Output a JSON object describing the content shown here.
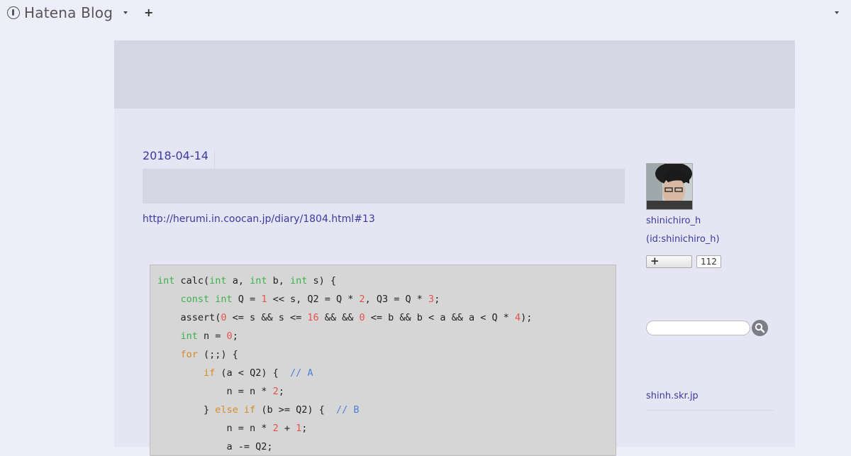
{
  "global_header": {
    "brand": "Hatena Blog",
    "add_label": "+",
    "logo_icon": "hatena-logo-icon"
  },
  "entry": {
    "date": "2018-04-14",
    "title": "",
    "link": "http://herumi.in.coocan.jp/diary/1804.html#13",
    "code_lines": [
      [
        [
          "t",
          "int"
        ],
        [
          "p",
          " calc("
        ],
        [
          "t",
          "int"
        ],
        [
          "p",
          " a, "
        ],
        [
          "t",
          "int"
        ],
        [
          "p",
          " b, "
        ],
        [
          "t",
          "int"
        ],
        [
          "p",
          " s) {"
        ]
      ],
      [
        [
          "p",
          "    "
        ],
        [
          "t",
          "const int"
        ],
        [
          "p",
          " Q = "
        ],
        [
          "n",
          "1"
        ],
        [
          "p",
          " << s, Q2 = Q * "
        ],
        [
          "n",
          "2"
        ],
        [
          "p",
          ", Q3 = Q * "
        ],
        [
          "n",
          "3"
        ],
        [
          "p",
          ";"
        ]
      ],
      [
        [
          "p",
          "    assert("
        ],
        [
          "n",
          "0"
        ],
        [
          "p",
          " <= s && s <= "
        ],
        [
          "n",
          "16"
        ],
        [
          "p",
          " && && "
        ],
        [
          "n",
          "0"
        ],
        [
          "p",
          " <= b && b < a && a < Q * "
        ],
        [
          "n",
          "4"
        ],
        [
          "p",
          ");"
        ]
      ],
      [
        [
          "p",
          "    "
        ],
        [
          "t",
          "int"
        ],
        [
          "p",
          " n = "
        ],
        [
          "n",
          "0"
        ],
        [
          "p",
          ";"
        ]
      ],
      [
        [
          "p",
          "    "
        ],
        [
          "c",
          "for"
        ],
        [
          "p",
          " (;;) {"
        ]
      ],
      [
        [
          "p",
          "        "
        ],
        [
          "c",
          "if"
        ],
        [
          "p",
          " (a < Q2) {  "
        ],
        [
          "m",
          "// A"
        ]
      ],
      [
        [
          "p",
          "            n = n * "
        ],
        [
          "n",
          "2"
        ],
        [
          "p",
          ";"
        ]
      ],
      [
        [
          "p",
          "        } "
        ],
        [
          "c",
          "else if"
        ],
        [
          "p",
          " (b >= Q2) {  "
        ],
        [
          "m",
          "// B"
        ]
      ],
      [
        [
          "p",
          "            n = n * "
        ],
        [
          "n",
          "2"
        ],
        [
          "p",
          " + "
        ],
        [
          "n",
          "1"
        ],
        [
          "p",
          ";"
        ]
      ],
      [
        [
          "p",
          "            a -= Q2;"
        ]
      ]
    ]
  },
  "sidebar": {
    "profile_name": "shinichiro_h",
    "profile_id": "(id:shinichiro_h)",
    "follow_label": "+",
    "follow_count": "112",
    "search_placeholder": "",
    "link_text": "shinh.skr.jp"
  },
  "colors": {
    "page_bg": "#eeeefa",
    "header_bg": "#d5d5e4",
    "link": "#3a3aa0",
    "code_bg": "#d6d6d6"
  }
}
